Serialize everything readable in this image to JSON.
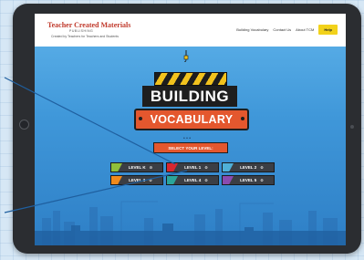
{
  "header": {
    "logo_line1": "Teacher Created Materials",
    "logo_line2": "PUBLISHING",
    "logo_line3": "Created by Teachers for Teachers and Students",
    "nav": [
      "Building Vocabulary",
      "Contact Us",
      "About TCM"
    ],
    "help_label": "Help"
  },
  "hero": {
    "title_top": "BUILDING",
    "title_bottom": "VOCABULARY",
    "dots": "• • •",
    "select_label": "SELECT YOUR LEVEL:"
  },
  "levels": [
    {
      "label": "LEVEL K",
      "color": "#8fbf3a"
    },
    {
      "label": "LEVEL 1",
      "color": "#d8262f"
    },
    {
      "label": "LEVEL 2",
      "color": "#4fb0d8"
    },
    {
      "label": "LEVEL 3",
      "color": "#f08a1c"
    },
    {
      "label": "LEVEL 4",
      "color": "#2aa59a"
    },
    {
      "label": "LEVEL 5",
      "color": "#8a4bb0"
    }
  ],
  "colors": {
    "accent": "#e4572e",
    "help": "#f2d21b",
    "sky": "#3f97d9"
  }
}
